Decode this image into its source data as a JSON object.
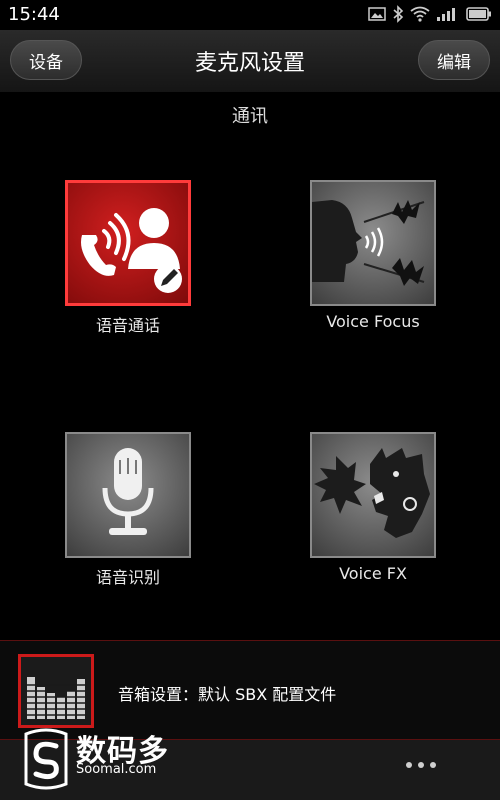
{
  "status_bar": {
    "time": "15:44",
    "icons": [
      "image-icon",
      "bluetooth-icon",
      "wifi-icon",
      "signal-icon",
      "battery-icon"
    ]
  },
  "header": {
    "left_button": "设备",
    "title": "麦克风设置",
    "right_button": "编辑"
  },
  "section_title": "通讯",
  "tiles": [
    {
      "label": "语音通话",
      "icon": "voice-call-icon",
      "active": true
    },
    {
      "label": "Voice Focus",
      "icon": "voice-focus-icon",
      "active": false
    },
    {
      "label": "语音识别",
      "icon": "microphone-icon",
      "active": false
    },
    {
      "label": "Voice FX",
      "icon": "voice-fx-icon",
      "active": false
    }
  ],
  "profile_bar": {
    "text": "音箱设置：默认 SBX 配置文件",
    "icon": "equalizer-icon"
  },
  "watermark": {
    "brand": "数码多",
    "domain": "Soomal.com"
  },
  "colors": {
    "accent_red": "#d11f1f",
    "background": "#000000"
  }
}
